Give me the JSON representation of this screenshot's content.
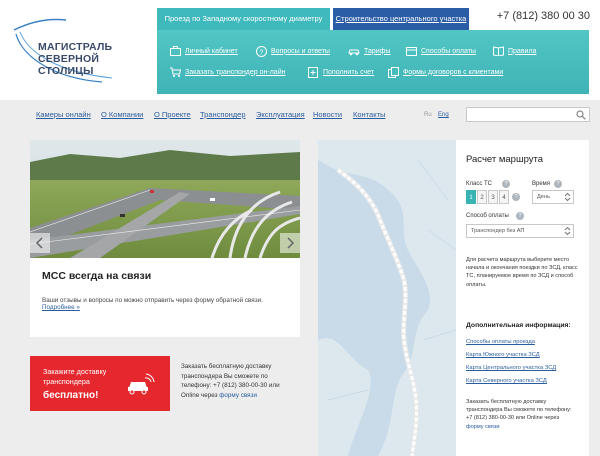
{
  "header": {
    "logo_line1": "МАГИСТРАЛЬ",
    "logo_line2": "СЕВЕРНОЙ СТОЛИЦЫ",
    "tab_active": "Проезд по Западному скоростному диаметру",
    "tab_other": "Строительство центрального участка",
    "phone": "+7 (812) 380 00 30",
    "menu": [
      {
        "label": "Личный кабинет",
        "icon": "briefcase-icon"
      },
      {
        "label": "Вопросы и ответы",
        "icon": "question-icon"
      },
      {
        "label": "Тарифы",
        "icon": "car-icon"
      },
      {
        "label": "Способы оплаты",
        "icon": "wallet-icon"
      },
      {
        "label": "Правила",
        "icon": "book-icon"
      },
      {
        "label": "Заказать транспондер он-лайн",
        "icon": "cart-icon"
      },
      {
        "label": "Пополнить счет",
        "icon": "plus-doc-icon"
      },
      {
        "label": "Формы договоров с клиентами",
        "icon": "documents-icon"
      }
    ]
  },
  "nav": {
    "links": [
      "Камеры онлайн",
      "О Компании",
      "О Проекте",
      "Транспондер",
      "Эксплуатация",
      "Новости",
      "Контакты"
    ],
    "lang_ru": "Ru",
    "lang_en": "Eng"
  },
  "hero": {
    "title": "МСС всегда на связи",
    "text": "Ваши отзывы и вопросы по можно отправить через форму обратной связи.",
    "link": "Подробнее »"
  },
  "promo": {
    "line1": "Закажите доставку",
    "line2": "транспондера",
    "line3": "бесплатно!",
    "text_pre": "Заказать бесплатную доставку транспондера Вы сможете по телефону: +7 (812) 380-00-30 или Online через ",
    "text_link": "форму связи"
  },
  "route": {
    "title": "Расчет маршрута",
    "class_label": "Класс ТС",
    "time_label": "Время",
    "classes": [
      "1",
      "2",
      "3",
      "4"
    ],
    "time_value": "День",
    "pay_label": "Способ оплаты",
    "pay_value": "Транспондер без АП",
    "instructions": "Для расчета маршрута выберите место начала и окончания поездки по ЗСД, класс ТС, планируемое время по ЗСД и способ оплаты.",
    "extra_title": "Дополнительная информация:",
    "extra_links": [
      "Способы оплаты проезда",
      "Карта Южного участка ЗСД",
      "Карта Центрального участка ЗСД",
      "Карта Северного участка ЗСД"
    ],
    "delivery_pre": "Заказать бесплатную доставку транспондера Вы сможете по телефону: +7 (812) 380-00-30 или Online через ",
    "delivery_link": "форму связи"
  }
}
